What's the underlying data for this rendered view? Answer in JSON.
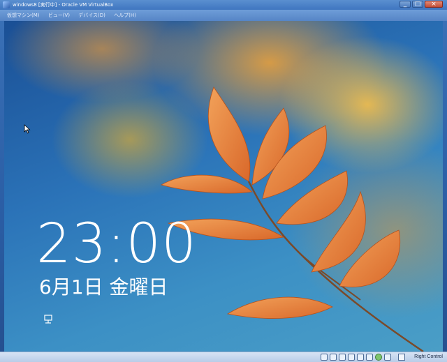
{
  "window": {
    "title": "windows8 [実行中] - Oracle VM VirtualBox"
  },
  "menubar": {
    "items": [
      "仮想マシン(M)",
      "ビュー(V)",
      "デバイス(D)",
      "ヘルプ(H)"
    ]
  },
  "lockscreen": {
    "time": "23:00",
    "date": "6月1日 金曜日",
    "network_icon": "network-icon"
  },
  "statusbar": {
    "host_key": "Right Control",
    "icons": [
      "hard-disk-icon",
      "optical-drive-icon",
      "usb-icon",
      "network-adapter-icon",
      "shared-folder-icon",
      "display-icon",
      "capture-icon",
      "mouse-integration-icon"
    ]
  },
  "colors": {
    "titlebar": "#3f76c0",
    "menubar": "#5685c6",
    "statusbar": "#b9cde8"
  }
}
